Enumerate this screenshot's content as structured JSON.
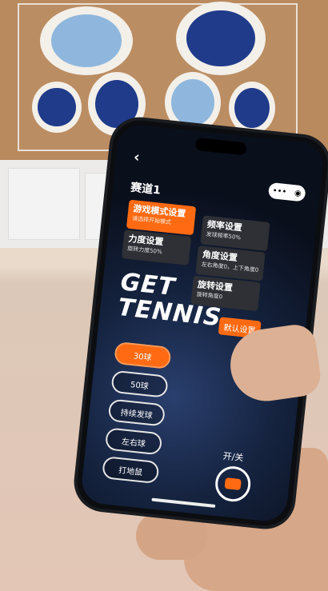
{
  "header": {
    "back_icon": "back-arrow-icon",
    "lane_title": "赛道1"
  },
  "capsule": {
    "more_icon": "more-icon",
    "close_icon": "close-circle-icon"
  },
  "cards": [
    {
      "title": "游戏模式设置",
      "subtitle": "请选择开始模式",
      "active": true
    },
    {
      "title": "频率设置",
      "subtitle": "发球频率50%",
      "active": false
    },
    {
      "title": "力度设置",
      "subtitle": "旋转力度50%",
      "active": false
    },
    {
      "title": "角度设置",
      "subtitle": "左右角度0，上下角度0",
      "active": false
    },
    {
      "title": "旋转设置",
      "subtitle": "旋转角度0",
      "active": false
    }
  ],
  "brand": {
    "line1": "GET",
    "line2": "TENNIS"
  },
  "default_button": "默认设置",
  "modes": [
    {
      "label": "30球",
      "selected": true
    },
    {
      "label": "50球",
      "selected": false
    },
    {
      "label": "持续发球",
      "selected": false
    },
    {
      "label": "左右球",
      "selected": false
    },
    {
      "label": "打地鼠",
      "selected": false
    }
  ],
  "power": {
    "label": "开/关",
    "icon": "power-switch-icon"
  },
  "colors": {
    "accent": "#ff6a13",
    "card": "#2e3035",
    "screen": "#0a0f1c"
  }
}
